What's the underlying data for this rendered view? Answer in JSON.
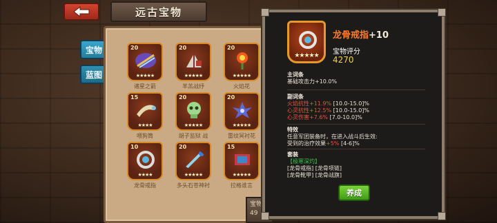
{
  "header": {
    "title": "远古宝物"
  },
  "tabs": [
    "宝物",
    "蓝图"
  ],
  "grid": [
    {
      "level": "20",
      "name": "诸星之箭"
    },
    {
      "level": "20",
      "name": "羊羔战纾"
    },
    {
      "level": "20",
      "name": "火焰花"
    },
    {
      "level": "15",
      "name": "喂狗筒"
    },
    {
      "level": "20",
      "name": "胡子监狱 战"
    },
    {
      "level": "20",
      "name": "雷纹冥衬花"
    },
    {
      "level": "10",
      "name": "龙骨戒指"
    },
    {
      "level": "20",
      "name": "多头石苍神衬"
    },
    {
      "level": "15",
      "name": "拉格谁言"
    }
  ],
  "score_stub": {
    "label": "宝物",
    "value": "49"
  },
  "detail": {
    "name": "龙骨戒指",
    "level": "+10",
    "rating_label": "宝物评分",
    "rating_value": "4270",
    "main_header": "主词条",
    "main_value": "基础攻击力+10.0%",
    "sub_header": "副词条",
    "sub_lines": [
      {
        "text": "火焰抗性+11.9%",
        "range": "[10.0-15.0]%"
      },
      {
        "text": "心灵抗性+12.5%",
        "range": "[10.0-15.0]%"
      },
      {
        "text": "心灵伤害+7.6%",
        "range": "[7.0-10.0]%"
      }
    ],
    "effect_header": "特效",
    "effect_line1": "任意军团装备时，在进入战斗后生效:",
    "effect_line2_prefix": "受到的治疗效果",
    "effect_line2_value": "+5%",
    "effect_line2_range": "[4-6]%",
    "set_header": "套装",
    "set_name": "【极寒深灼】",
    "set_items": [
      "[龙骨戒指]",
      "[龙骨项链]",
      "[龙骨靴甲]",
      "[龙骨战旗]"
    ],
    "foster_label": "养成"
  },
  "colors": {
    "title_orange": "#ff7a2a",
    "rating_gold": "#f4d34a",
    "buff_red": "#e4563c",
    "set_green": "#38c24a"
  }
}
